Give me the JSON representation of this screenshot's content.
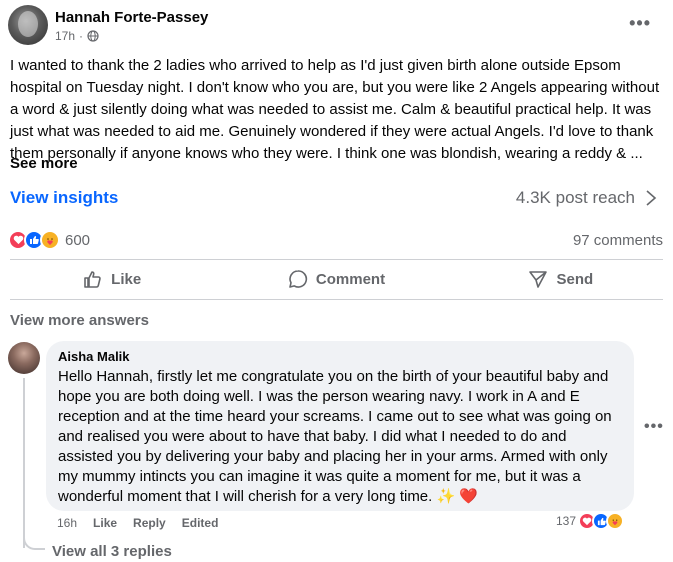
{
  "post": {
    "author": "Hannah Forte-Passey",
    "time": "17h",
    "dot": "·",
    "more": "•••",
    "text": "I wanted to thank the 2 ladies who arrived to help as I'd just given birth alone outside Epsom hospital on Tuesday night. I don't know who you are, but you were like 2 Angels appearing without a word & just silently doing what was needed to assist me. Calm & beautiful practical help. It was just what was needed to aid me. Genuinely wondered if they were actual Angels. I'd love to thank them personally if anyone knows who they were. I think one was blondish, wearing a reddy & ...",
    "see_more": "See more",
    "insights": "View insights",
    "reach": "4.3K post reach",
    "reaction_count": "600",
    "comments_count": "97 comments"
  },
  "actions": {
    "like": "Like",
    "comment": "Comment",
    "send": "Send"
  },
  "view_more_answers": "View more answers",
  "comment": {
    "author": "Aisha Malik",
    "text": "Hello Hannah, firstly let me congratulate you on the birth of your beautiful baby and hope you are both doing well. I was the person wearing navy. I work in A and E reception and at the time heard your screams. I came out to see what was going on and realised you were about to have that baby. I did what I needed to do and assisted you by delivering your baby and placing her in your arms. Armed with only my mummy intincts you can imagine it was quite a moment for me, but it was a wonderful moment that I will cherish for a very long time.",
    "emoji_sparkle": "✨",
    "emoji_heart": "❤️",
    "time": "16h",
    "like": "Like",
    "reply": "Reply",
    "edited": "Edited",
    "reaction_count": "137",
    "more": "•••"
  },
  "view_replies": "View all 3 replies",
  "colors": {
    "accent": "#0866ff",
    "love": "#f33e58",
    "care": "#f7b125",
    "secondary_text": "#65676b",
    "bubble": "#f0f2f5"
  },
  "icons": [
    "globe-icon",
    "more-icon",
    "chevron-right-icon",
    "love-reaction-icon",
    "like-reaction-icon",
    "care-reaction-icon",
    "thumbs-up-icon",
    "comment-icon",
    "send-icon"
  ]
}
